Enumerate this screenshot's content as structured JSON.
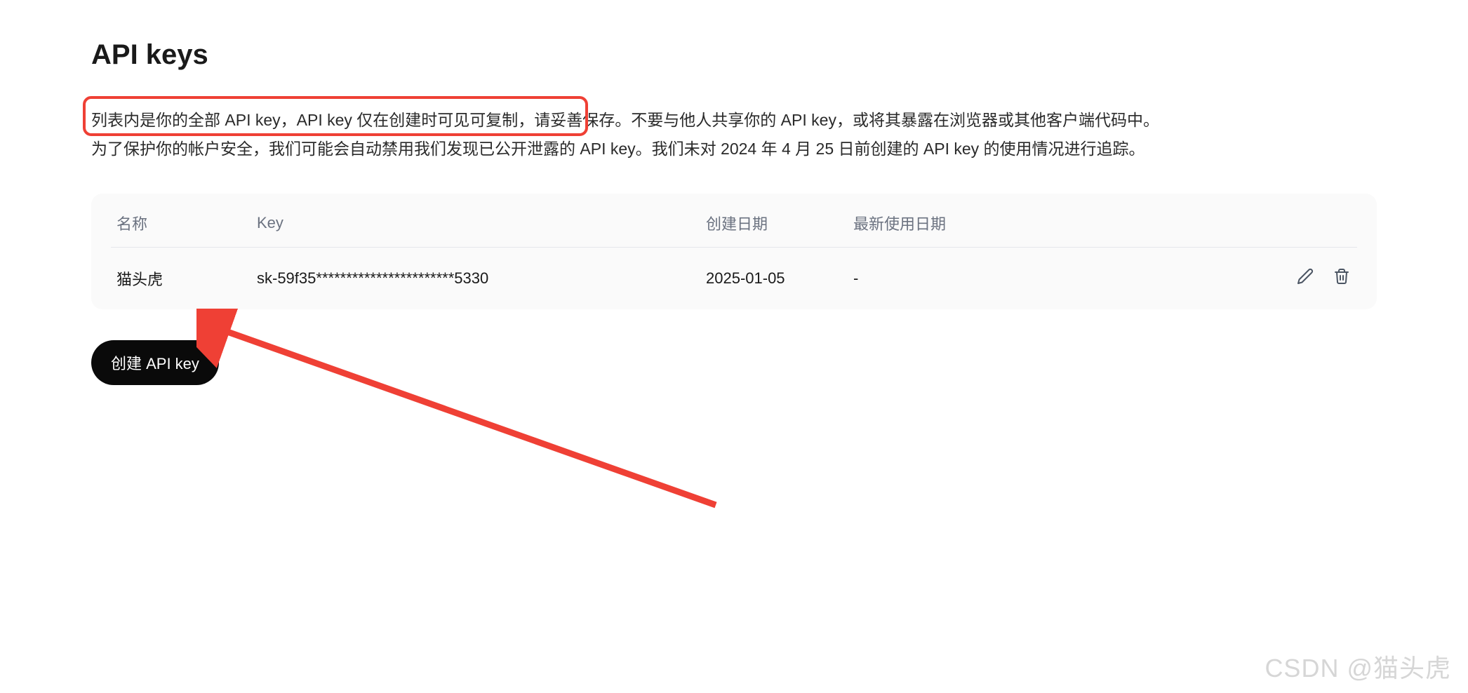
{
  "page": {
    "title": "API keys"
  },
  "description": {
    "line1_part1": "列表内是你的全部 API key，API key 仅在创建时可见可复制，请妥善保存。",
    "line1_part2": "不要与他人共享你的 API key，或将其暴露在浏览器或其他客户端代码中。",
    "line2": "为了保护你的帐户安全，我们可能会自动禁用我们发现已公开泄露的 API key。我们未对 2024 年 4 月 25 日前创建的 API key 的使用情况进行追踪。"
  },
  "table": {
    "headers": {
      "name": "名称",
      "key": "Key",
      "created": "创建日期",
      "lastUsed": "最新使用日期"
    },
    "rows": [
      {
        "name": "猫头虎",
        "key": "sk-59f35***********************5330",
        "created": "2025-01-05",
        "lastUsed": "-"
      }
    ]
  },
  "actions": {
    "createButton": "创建 API key"
  },
  "watermark": "CSDN @猫头虎",
  "annotations": {
    "highlight_color": "#ef4035",
    "arrow_color": "#ef4035"
  }
}
